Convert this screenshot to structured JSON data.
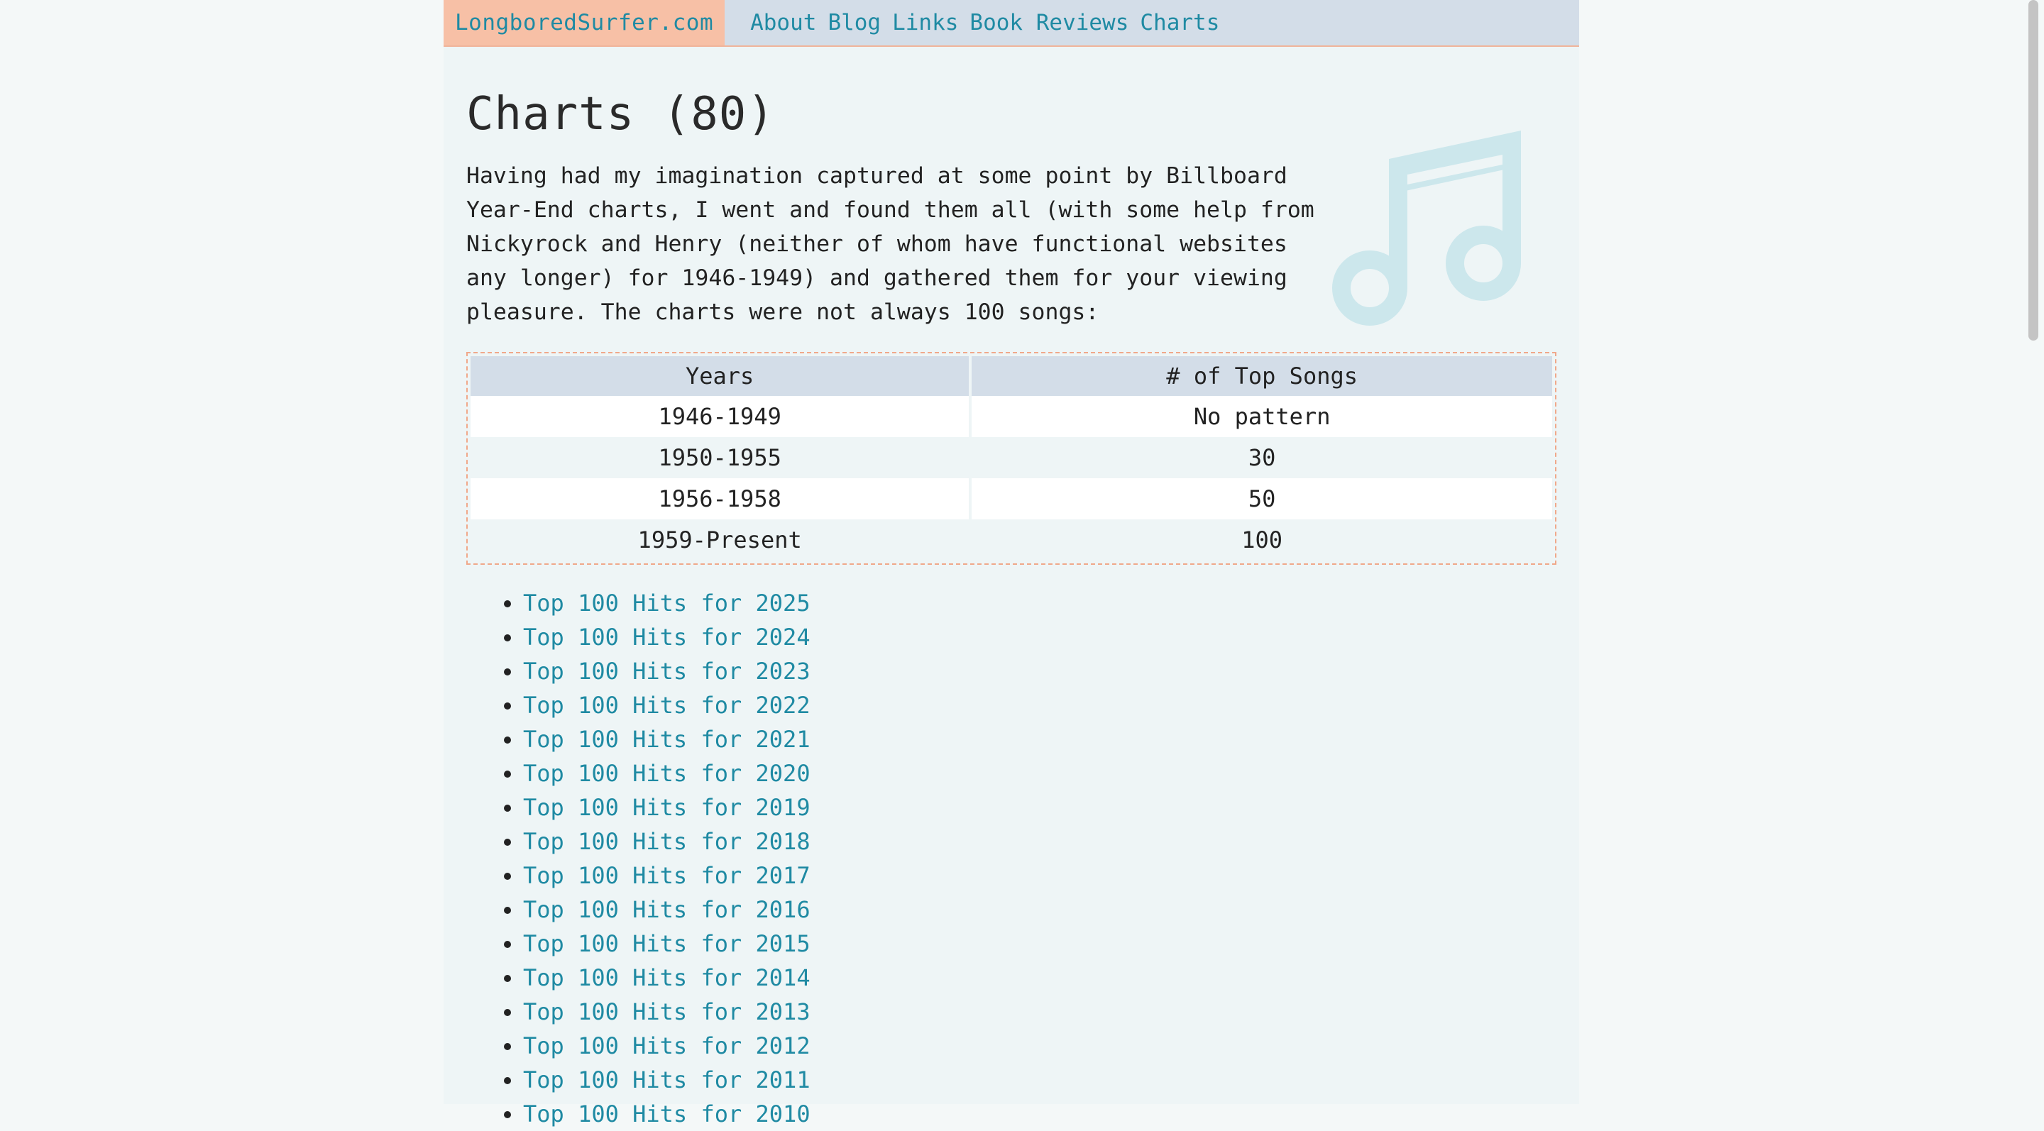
{
  "nav": {
    "brand": "LongboredSurfer.com",
    "links": [
      "About",
      "Blog",
      "Links",
      "Book Reviews",
      "Charts"
    ]
  },
  "page": {
    "title": "Charts (80)",
    "intro": "Having had my imagination captured at some point by Billboard Year-End charts, I went and found them all (with some help from Nickyrock and Henry (neither of whom have functional websites any longer) for 1946-1949) and gathered them for your viewing pleasure. The charts were not always 100 songs:"
  },
  "table": {
    "headers": [
      "Years",
      "# of Top Songs"
    ],
    "rows": [
      [
        "1946-1949",
        "No pattern"
      ],
      [
        "1950-1955",
        "30"
      ],
      [
        "1956-1958",
        "50"
      ],
      [
        "1959-Present",
        "100"
      ]
    ]
  },
  "charts": [
    "Top 100 Hits for 2025",
    "Top 100 Hits for 2024",
    "Top 100 Hits for 2023",
    "Top 100 Hits for 2022",
    "Top 100 Hits for 2021",
    "Top 100 Hits for 2020",
    "Top 100 Hits for 2019",
    "Top 100 Hits for 2018",
    "Top 100 Hits for 2017",
    "Top 100 Hits for 2016",
    "Top 100 Hits for 2015",
    "Top 100 Hits for 2014",
    "Top 100 Hits for 2013",
    "Top 100 Hits for 2012",
    "Top 100 Hits for 2011",
    "Top 100 Hits for 2010"
  ],
  "icons": {
    "decoration": "music-note-icon"
  },
  "colors": {
    "link": "#1f8aa3",
    "brand_bg": "#f7c0a6",
    "nav_bg": "#d3dde8",
    "icon": "#cce7ec"
  }
}
